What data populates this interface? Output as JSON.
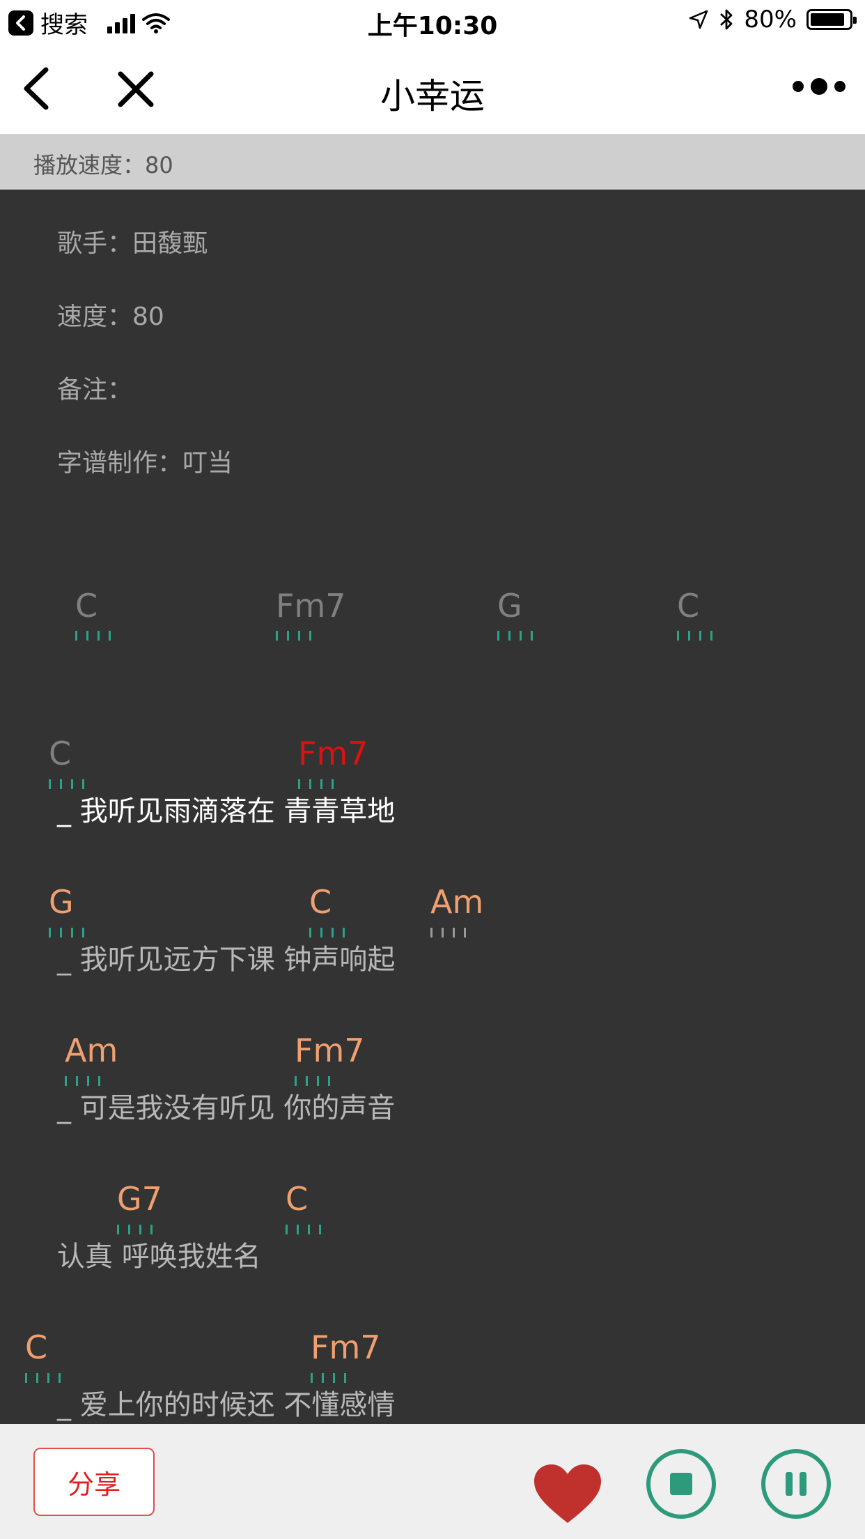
{
  "status_bar": {
    "back_app": "搜索",
    "time": "上午10:30",
    "battery": "80%",
    "battery_level": 0.8
  },
  "nav": {
    "title": "小幸运"
  },
  "speed_bar": {
    "label": "播放速度：80"
  },
  "meta": {
    "singer": "歌手：田馥甄",
    "tempo": "速度：80",
    "note": "备注：",
    "maker": "字谱制作：叮当"
  },
  "intro": [
    "C",
    "Fm7",
    "G",
    "C"
  ],
  "lines": [
    {
      "chords": [
        "C",
        "Fm7"
      ],
      "lyric": "_ 我听见雨滴落在 青青草地"
    },
    {
      "chords": [
        "G",
        "C",
        "Am"
      ],
      "lyric": "_ 我听见远方下课 钟声响起"
    },
    {
      "chords": [
        "Am",
        "Fm7"
      ],
      "lyric": "_ 可是我没有听见 你的声音"
    },
    {
      "chords": [
        "G7",
        "C"
      ],
      "lyric": "认真 呼唤我姓名"
    },
    {
      "chords": [
        "C",
        "Fm7"
      ],
      "lyric": "_ 爱上你的时候还 不懂感情"
    }
  ],
  "bottom": {
    "share_label": "分享"
  },
  "colors": {
    "background": "#333333",
    "chord_played": "#808080",
    "chord_current": "#e01010",
    "chord_upcoming": "#f0a070",
    "beat_marks": "#2aa38a",
    "control_green": "#2e9a7c",
    "heart_red": "#c0302c"
  }
}
